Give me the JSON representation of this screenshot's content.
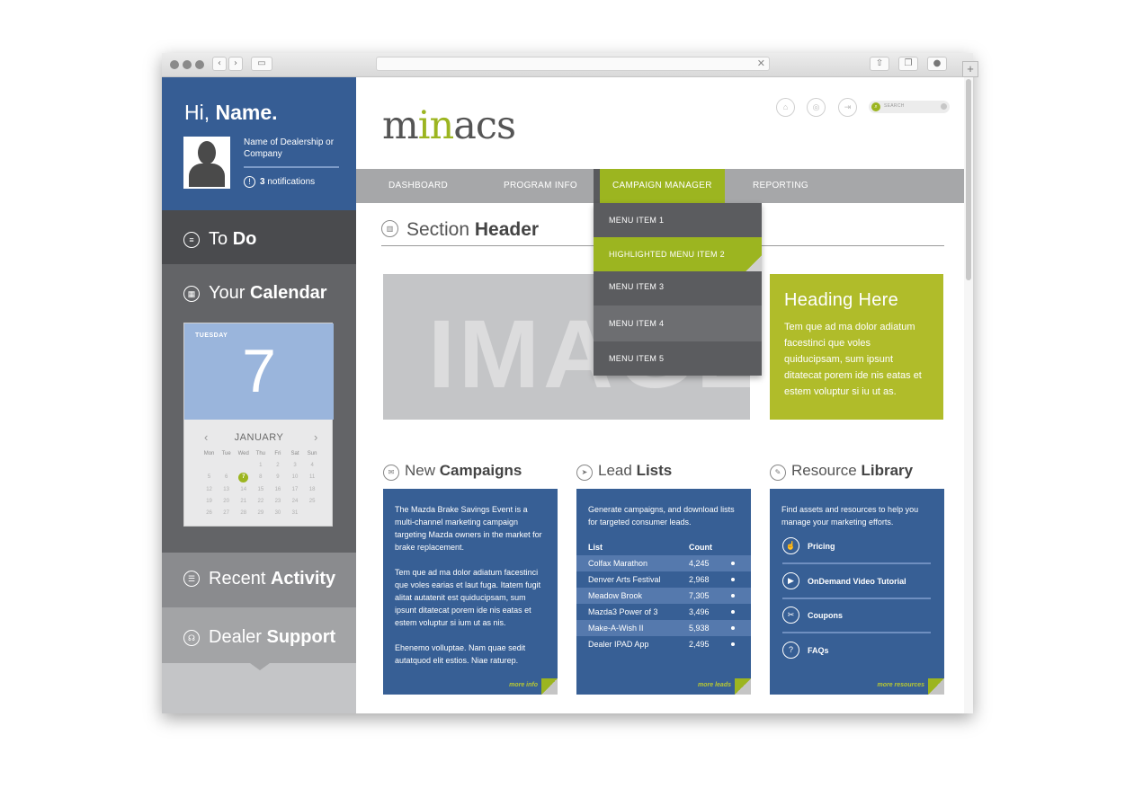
{
  "sidebar": {
    "greeting": "Hi,",
    "name": "Name.",
    "dealer": "Name of Dealership or Company",
    "notif_count": "3",
    "notif_label": "notifications",
    "todo_light": "To",
    "todo_bold": "Do",
    "calendar_light": "Your",
    "calendar_bold": "Calendar",
    "recent_light": "Recent",
    "recent_bold": "Activity",
    "support_light": "Dealer",
    "support_bold": "Support"
  },
  "calendar": {
    "weekday": "TUESDAY",
    "day": "7",
    "month": "JANUARY",
    "headers": [
      "Mon",
      "Tue",
      "Wed",
      "Thu",
      "Fri",
      "Sat",
      "Sun"
    ],
    "rows": [
      [
        "",
        "",
        "",
        "1",
        "2",
        "3",
        "4"
      ],
      [
        "5",
        "6",
        "7",
        "8",
        "9",
        "10",
        "11"
      ],
      [
        "12",
        "13",
        "14",
        "15",
        "16",
        "17",
        "18"
      ],
      [
        "19",
        "20",
        "21",
        "22",
        "23",
        "24",
        "25"
      ],
      [
        "26",
        "27",
        "28",
        "29",
        "30",
        "31",
        ""
      ]
    ],
    "today": "7"
  },
  "header": {
    "logo_a": "m",
    "logo_b": "in",
    "logo_c": "acs",
    "search_placeholder": "SEARCH"
  },
  "nav": {
    "items": [
      "DASHBOARD",
      "PROGRAM INFO",
      "CAMPAIGN MANAGER",
      "REPORTING"
    ],
    "dropdown": [
      "MENU ITEM 1",
      "HIGHLIGHTED MENU ITEM 2",
      "MENU ITEM 3",
      "MENU ITEM 4",
      "MENU ITEM 5"
    ]
  },
  "section": {
    "light": "Section",
    "bold": "Header"
  },
  "image_placeholder": "IMAGE",
  "feature": {
    "heading": "Heading  Here",
    "body": "Tem que ad ma dolor adiatum facestinci que voles quiducipsam, sum ipsunt ditatecat porem ide nis eatas et estem voluptur si iu ut as."
  },
  "campaigns": {
    "light": "New",
    "bold": "Campaigns",
    "p1": "The Mazda Brake Savings Event is a multi-channel marketing campaign targeting Mazda owners in the market for brake replacement.",
    "p2": "Tem que ad ma dolor adiatum facestinci que voles earias et laut fuga. Itatem fugit alitat autatenit est quiducipsam, sum ipsunt ditatecat porem ide nis eatas et estem voluptur si ium ut as nis.",
    "p3": "Ehenemo volluptae. Nam quae sedit autatquod elit estios. Niae raturep.",
    "more": "more info"
  },
  "leads": {
    "light": "Lead",
    "bold": "Lists",
    "intro": "Generate campaigns, and download lists for targeted consumer leads.",
    "col_list": "List",
    "col_count": "Count",
    "rows": [
      {
        "name": "Colfax Marathon",
        "count": "4,245"
      },
      {
        "name": "Denver Arts Festival",
        "count": "2,968"
      },
      {
        "name": "Meadow Brook",
        "count": "7,305"
      },
      {
        "name": "Mazda3 Power of 3",
        "count": "3,496"
      },
      {
        "name": "Make-A-Wish II",
        "count": "5,938"
      },
      {
        "name": "Dealer IPAD App",
        "count": "2,495"
      }
    ],
    "more": "more leads"
  },
  "resources": {
    "light": "Resource",
    "bold": "Library",
    "intro": "Find assets and resources to help you manage your marketing efforts.",
    "items": [
      "Pricing",
      "OnDemand Video Tutorial",
      "Coupons",
      "FAQs"
    ],
    "more": "more resources"
  }
}
